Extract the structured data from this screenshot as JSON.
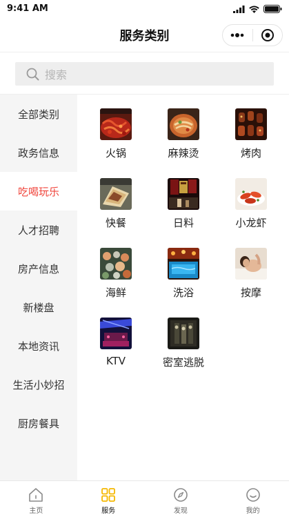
{
  "status_bar": {
    "time": "9:41 AM"
  },
  "nav": {
    "title": "服务类别"
  },
  "search": {
    "placeholder": "搜索"
  },
  "sidebar": {
    "items": [
      {
        "label": "全部类别",
        "active": false
      },
      {
        "label": "政务信息",
        "active": false
      },
      {
        "label": "吃喝玩乐",
        "active": true
      },
      {
        "label": "人才招聘",
        "active": false
      },
      {
        "label": "房产信息",
        "active": false
      },
      {
        "label": "新楼盘",
        "active": false
      },
      {
        "label": "本地资讯",
        "active": false
      },
      {
        "label": "生活小妙招",
        "active": false
      },
      {
        "label": "厨房餐具",
        "active": false
      }
    ]
  },
  "grid": {
    "items": [
      {
        "label": "火锅",
        "icon": "hotpot-photo"
      },
      {
        "label": "麻辣烫",
        "icon": "malatang-photo"
      },
      {
        "label": "烤肉",
        "icon": "bbq-photo"
      },
      {
        "label": "快餐",
        "icon": "fastfood-photo"
      },
      {
        "label": "日料",
        "icon": "japanese-food-photo"
      },
      {
        "label": "小龙虾",
        "icon": "crayfish-photo"
      },
      {
        "label": "海鲜",
        "icon": "seafood-photo"
      },
      {
        "label": "洗浴",
        "icon": "bath-photo"
      },
      {
        "label": "按摩",
        "icon": "massage-photo"
      },
      {
        "label": "KTV",
        "icon": "ktv-photo"
      },
      {
        "label": "密室逃脱",
        "icon": "escape-room-photo"
      }
    ]
  },
  "tabbar": {
    "items": [
      {
        "label": "主页",
        "icon": "home-icon",
        "active": false
      },
      {
        "label": "服务",
        "icon": "grid-icon",
        "active": true
      },
      {
        "label": "发现",
        "icon": "compass-icon",
        "active": false
      },
      {
        "label": "我的",
        "icon": "smile-icon",
        "active": false
      }
    ]
  },
  "colors": {
    "accent": "#f0443b",
    "tab_active": "#f5b800",
    "sidebar_bg": "#f5f5f5",
    "search_bg": "#eeeeee"
  }
}
